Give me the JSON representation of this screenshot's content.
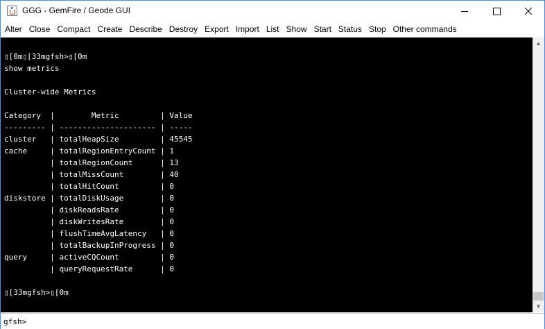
{
  "window": {
    "title": "GGG - GemFire / Geode GUI"
  },
  "menu": {
    "items": [
      {
        "label": "Alter"
      },
      {
        "label": "Close"
      },
      {
        "label": "Compact"
      },
      {
        "label": "Create"
      },
      {
        "label": "Describe"
      },
      {
        "label": "Destroy"
      },
      {
        "label": "Export"
      },
      {
        "label": "Import"
      },
      {
        "label": "List"
      },
      {
        "label": "Show"
      },
      {
        "label": "Start"
      },
      {
        "label": "Status"
      },
      {
        "label": "Stop"
      },
      {
        "label": "Other commands"
      }
    ]
  },
  "console": {
    "lines": [
      "▯[0m▯[33mgfsh>▯[0m",
      "show metrics",
      "",
      "Cluster-wide Metrics",
      "",
      "Category  |        Metric         | Value",
      "--------- | --------------------- | -----",
      "cluster   | totalHeapSize         | 45545",
      "cache     | totalRegionEntryCount | 1",
      "          | totalRegionCount      | 13",
      "          | totalMissCount        | 40",
      "          | totalHitCount         | 0",
      "diskstore | totalDiskUsage        | 0",
      "          | diskReadsRate         | 0",
      "          | diskWritesRate        | 0",
      "          | flushTimeAvgLatency   | 0",
      "          | totalBackupInProgress | 0",
      "query     | activeCQCount         | 0",
      "          | queryRequestRate      | 0",
      "",
      "▯[33mgfsh>▯[0m"
    ]
  },
  "input": {
    "value": "gfsh>"
  },
  "colors": {
    "console_bg": "#000000",
    "console_fg": "#ffffff",
    "window_border": "#4a8fd6"
  },
  "icons": {
    "app": "java-cup-icon",
    "minimize": "minimize-icon",
    "maximize": "maximize-icon",
    "close": "close-icon",
    "scroll_up": "scroll-up-arrow-icon",
    "scroll_down": "scroll-down-arrow-icon"
  }
}
